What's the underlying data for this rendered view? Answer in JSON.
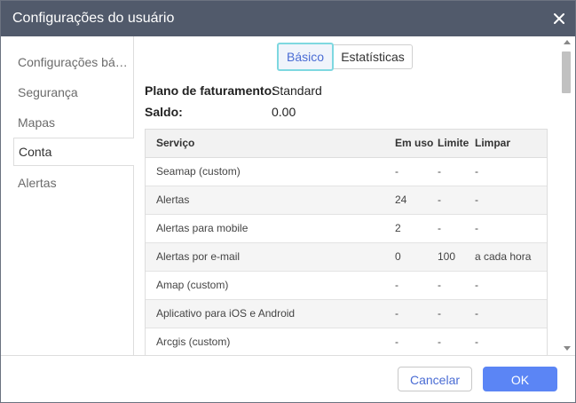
{
  "dialog": {
    "title": "Configurações do usuário"
  },
  "sidebar": {
    "items": [
      {
        "label": "Configurações básicas"
      },
      {
        "label": "Segurança"
      },
      {
        "label": "Mapas"
      },
      {
        "label": "Conta"
      },
      {
        "label": "Alertas"
      }
    ],
    "active_index": 3
  },
  "tabs": {
    "basic": "Básico",
    "stats": "Estatísticas"
  },
  "account": {
    "plan_label": "Plano de faturamento:",
    "plan_value": "Standard",
    "balance_label": "Saldo:",
    "balance_value": "0.00"
  },
  "table": {
    "headers": [
      "Serviço",
      "Em uso",
      "Limite",
      "Limpar"
    ],
    "rows": [
      [
        "Seamap (custom)",
        "-",
        "-",
        "-"
      ],
      [
        "Alertas",
        "24",
        "-",
        "-"
      ],
      [
        "Alertas para mobile",
        "2",
        "-",
        "-"
      ],
      [
        "Alertas por e-mail",
        "0",
        "100",
        "a cada hora"
      ],
      [
        "Amap (custom)",
        "-",
        "-",
        "-"
      ],
      [
        "Aplicativo para iOS e Android",
        "-",
        "-",
        "-"
      ],
      [
        "Arcgis (custom)",
        "-",
        "-",
        "-"
      ]
    ]
  },
  "footer": {
    "cancel_label": "Cancelar",
    "ok_label": "OK"
  },
  "colors": {
    "titlebar": "#515a6b",
    "accent": "#5b85f5",
    "tab_focus_border": "#7ed8e0"
  }
}
